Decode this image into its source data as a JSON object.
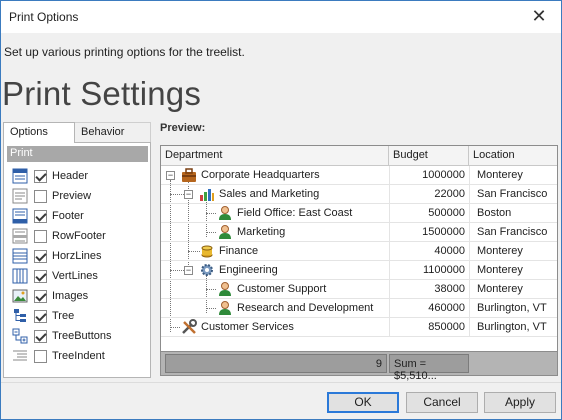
{
  "window": {
    "title": "Print Options",
    "close_glyph": "✕"
  },
  "subtitle": "Set up various printing options for the treelist.",
  "heading": "Print Settings",
  "tabs": [
    {
      "label": "Options",
      "active": true
    },
    {
      "label": "Behavior",
      "active": false
    }
  ],
  "group_header": "Print",
  "options": [
    {
      "label": "Header",
      "checked": true,
      "icon": "header-icon"
    },
    {
      "label": "Preview",
      "checked": false,
      "icon": "preview-icon"
    },
    {
      "label": "Footer",
      "checked": true,
      "icon": "footer-icon"
    },
    {
      "label": "RowFooter",
      "checked": false,
      "icon": "row-footer-icon"
    },
    {
      "label": "HorzLines",
      "checked": true,
      "icon": "horz-lines-icon"
    },
    {
      "label": "VertLines",
      "checked": true,
      "icon": "vert-lines-icon"
    },
    {
      "label": "Images",
      "checked": true,
      "icon": "images-icon"
    },
    {
      "label": "Tree",
      "checked": true,
      "icon": "tree-icon"
    },
    {
      "label": "TreeButtons",
      "checked": true,
      "icon": "tree-buttons-icon"
    },
    {
      "label": "TreeIndent",
      "checked": false,
      "icon": "tree-indent-icon"
    }
  ],
  "preview_label": "Preview:",
  "grid": {
    "columns": [
      "Department",
      "Budget",
      "Location"
    ],
    "rows": [
      {
        "department": "Corporate Headquarters",
        "budget": "1000000",
        "location": "Monterey",
        "level": 0,
        "icon": "briefcase-icon",
        "expanded": true
      },
      {
        "department": "Sales and Marketing",
        "budget": "22000",
        "location": "San Francisco",
        "level": 1,
        "icon": "bar-chart-icon",
        "expanded": true
      },
      {
        "department": "Field Office: East Coast",
        "budget": "500000",
        "location": "Boston",
        "level": 2,
        "icon": "person-icon"
      },
      {
        "department": "Marketing",
        "budget": "1500000",
        "location": "San Francisco",
        "level": 2,
        "icon": "person-icon"
      },
      {
        "department": "Finance",
        "budget": "40000",
        "location": "Monterey",
        "level": 1,
        "icon": "coins-icon"
      },
      {
        "department": "Engineering",
        "budget": "1100000",
        "location": "Monterey",
        "level": 1,
        "icon": "gear-icon",
        "expanded": true
      },
      {
        "department": "Customer Support",
        "budget": "38000",
        "location": "Monterey",
        "level": 2,
        "icon": "person-icon"
      },
      {
        "department": "Research and Development",
        "budget": "460000",
        "location": "Burlington, VT",
        "level": 2,
        "icon": "person-icon"
      },
      {
        "department": "Customer Services",
        "budget": "850000",
        "location": "Burlington, VT",
        "level": 0,
        "icon": "tools-icon"
      }
    ],
    "footer": {
      "count": "9",
      "sum": "Sum = $5,510..."
    }
  },
  "buttons": {
    "ok": "OK",
    "cancel": "Cancel",
    "apply": "Apply"
  }
}
